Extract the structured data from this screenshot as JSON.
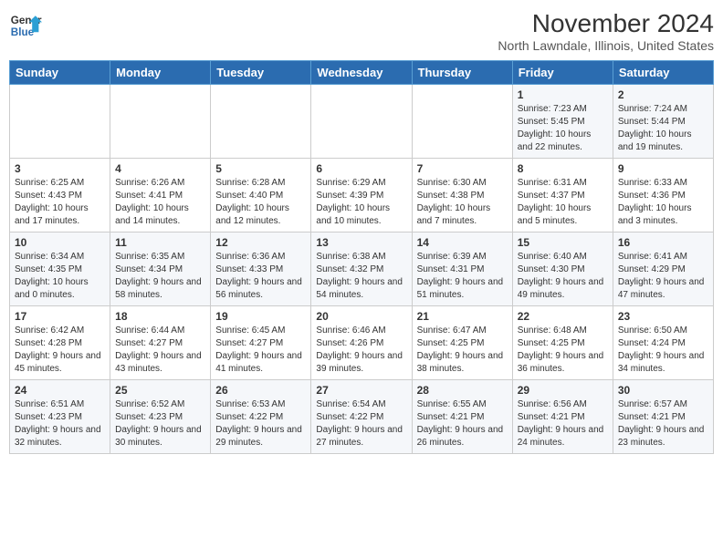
{
  "header": {
    "logo_line1": "General",
    "logo_line2": "Blue",
    "month_title": "November 2024",
    "location": "North Lawndale, Illinois, United States"
  },
  "days_of_week": [
    "Sunday",
    "Monday",
    "Tuesday",
    "Wednesday",
    "Thursday",
    "Friday",
    "Saturday"
  ],
  "weeks": [
    [
      {
        "day": "",
        "info": ""
      },
      {
        "day": "",
        "info": ""
      },
      {
        "day": "",
        "info": ""
      },
      {
        "day": "",
        "info": ""
      },
      {
        "day": "",
        "info": ""
      },
      {
        "day": "1",
        "info": "Sunrise: 7:23 AM\nSunset: 5:45 PM\nDaylight: 10 hours and 22 minutes."
      },
      {
        "day": "2",
        "info": "Sunrise: 7:24 AM\nSunset: 5:44 PM\nDaylight: 10 hours and 19 minutes."
      }
    ],
    [
      {
        "day": "3",
        "info": "Sunrise: 6:25 AM\nSunset: 4:43 PM\nDaylight: 10 hours and 17 minutes."
      },
      {
        "day": "4",
        "info": "Sunrise: 6:26 AM\nSunset: 4:41 PM\nDaylight: 10 hours and 14 minutes."
      },
      {
        "day": "5",
        "info": "Sunrise: 6:28 AM\nSunset: 4:40 PM\nDaylight: 10 hours and 12 minutes."
      },
      {
        "day": "6",
        "info": "Sunrise: 6:29 AM\nSunset: 4:39 PM\nDaylight: 10 hours and 10 minutes."
      },
      {
        "day": "7",
        "info": "Sunrise: 6:30 AM\nSunset: 4:38 PM\nDaylight: 10 hours and 7 minutes."
      },
      {
        "day": "8",
        "info": "Sunrise: 6:31 AM\nSunset: 4:37 PM\nDaylight: 10 hours and 5 minutes."
      },
      {
        "day": "9",
        "info": "Sunrise: 6:33 AM\nSunset: 4:36 PM\nDaylight: 10 hours and 3 minutes."
      }
    ],
    [
      {
        "day": "10",
        "info": "Sunrise: 6:34 AM\nSunset: 4:35 PM\nDaylight: 10 hours and 0 minutes."
      },
      {
        "day": "11",
        "info": "Sunrise: 6:35 AM\nSunset: 4:34 PM\nDaylight: 9 hours and 58 minutes."
      },
      {
        "day": "12",
        "info": "Sunrise: 6:36 AM\nSunset: 4:33 PM\nDaylight: 9 hours and 56 minutes."
      },
      {
        "day": "13",
        "info": "Sunrise: 6:38 AM\nSunset: 4:32 PM\nDaylight: 9 hours and 54 minutes."
      },
      {
        "day": "14",
        "info": "Sunrise: 6:39 AM\nSunset: 4:31 PM\nDaylight: 9 hours and 51 minutes."
      },
      {
        "day": "15",
        "info": "Sunrise: 6:40 AM\nSunset: 4:30 PM\nDaylight: 9 hours and 49 minutes."
      },
      {
        "day": "16",
        "info": "Sunrise: 6:41 AM\nSunset: 4:29 PM\nDaylight: 9 hours and 47 minutes."
      }
    ],
    [
      {
        "day": "17",
        "info": "Sunrise: 6:42 AM\nSunset: 4:28 PM\nDaylight: 9 hours and 45 minutes."
      },
      {
        "day": "18",
        "info": "Sunrise: 6:44 AM\nSunset: 4:27 PM\nDaylight: 9 hours and 43 minutes."
      },
      {
        "day": "19",
        "info": "Sunrise: 6:45 AM\nSunset: 4:27 PM\nDaylight: 9 hours and 41 minutes."
      },
      {
        "day": "20",
        "info": "Sunrise: 6:46 AM\nSunset: 4:26 PM\nDaylight: 9 hours and 39 minutes."
      },
      {
        "day": "21",
        "info": "Sunrise: 6:47 AM\nSunset: 4:25 PM\nDaylight: 9 hours and 38 minutes."
      },
      {
        "day": "22",
        "info": "Sunrise: 6:48 AM\nSunset: 4:25 PM\nDaylight: 9 hours and 36 minutes."
      },
      {
        "day": "23",
        "info": "Sunrise: 6:50 AM\nSunset: 4:24 PM\nDaylight: 9 hours and 34 minutes."
      }
    ],
    [
      {
        "day": "24",
        "info": "Sunrise: 6:51 AM\nSunset: 4:23 PM\nDaylight: 9 hours and 32 minutes."
      },
      {
        "day": "25",
        "info": "Sunrise: 6:52 AM\nSunset: 4:23 PM\nDaylight: 9 hours and 30 minutes."
      },
      {
        "day": "26",
        "info": "Sunrise: 6:53 AM\nSunset: 4:22 PM\nDaylight: 9 hours and 29 minutes."
      },
      {
        "day": "27",
        "info": "Sunrise: 6:54 AM\nSunset: 4:22 PM\nDaylight: 9 hours and 27 minutes."
      },
      {
        "day": "28",
        "info": "Sunrise: 6:55 AM\nSunset: 4:21 PM\nDaylight: 9 hours and 26 minutes."
      },
      {
        "day": "29",
        "info": "Sunrise: 6:56 AM\nSunset: 4:21 PM\nDaylight: 9 hours and 24 minutes."
      },
      {
        "day": "30",
        "info": "Sunrise: 6:57 AM\nSunset: 4:21 PM\nDaylight: 9 hours and 23 minutes."
      }
    ]
  ]
}
